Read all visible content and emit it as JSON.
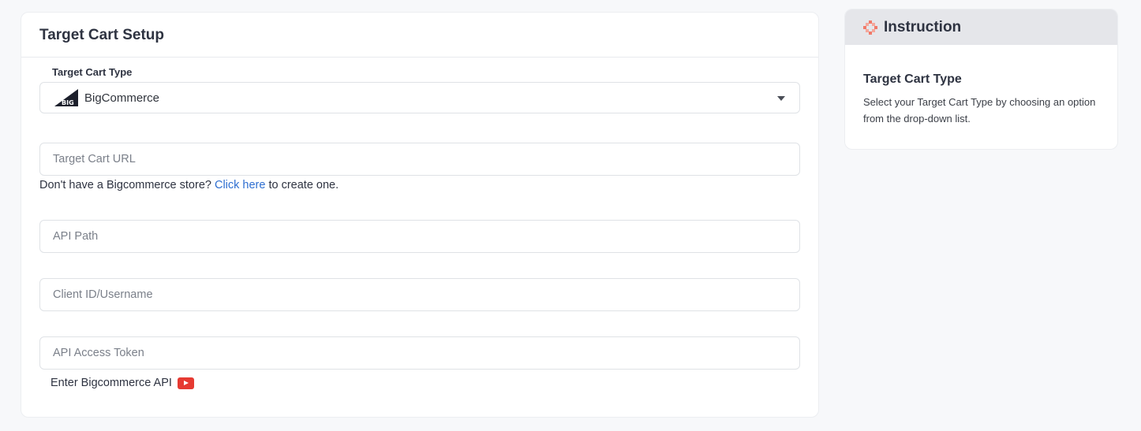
{
  "setup": {
    "title": "Target Cart Setup",
    "cart_type_label": "Target Cart Type",
    "cart_type_value": "BigCommerce",
    "cart_type_icon": "bigcommerce-logo-icon",
    "target_url_placeholder": "Target Cart URL",
    "helper_prefix": "Don't have a Bigcommerce store? ",
    "helper_link": "Click here",
    "helper_suffix": " to create one.",
    "api_path_placeholder": "API Path",
    "client_id_placeholder": "Client ID/Username",
    "token_placeholder": "API Access Token",
    "api_help_text": "Enter Bigcommerce API",
    "api_help_icon": "youtube-icon",
    "link_color": "#2f6fd1",
    "youtube_color": "#e63a32"
  },
  "instruction": {
    "title": "Instruction",
    "icon": "instruction-icon",
    "icon_color": "#f07a6a",
    "subtitle": "Target Cart Type",
    "text": "Select your Target Cart Type by choosing an option from the drop-down list."
  }
}
